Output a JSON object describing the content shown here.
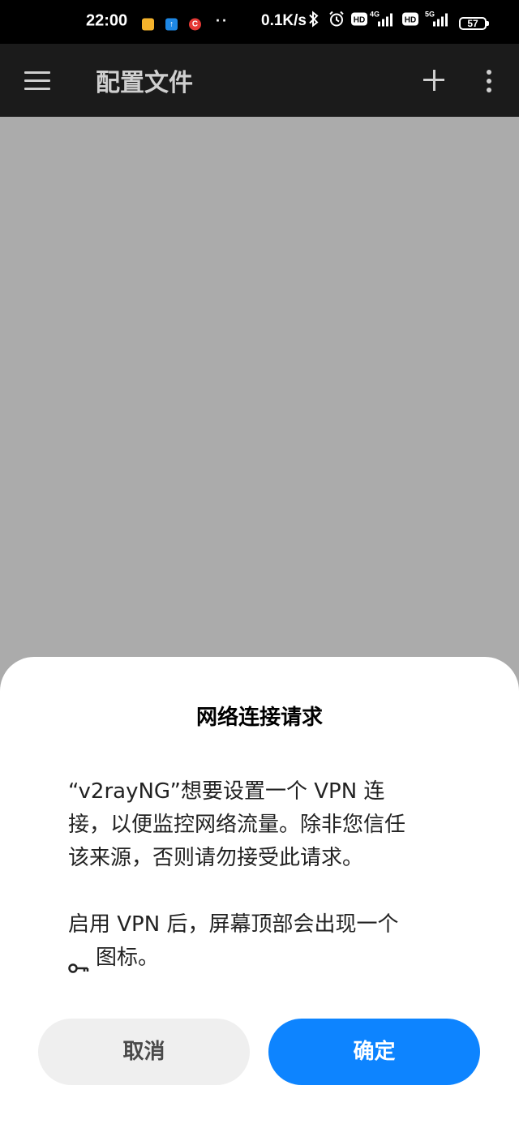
{
  "status_bar": {
    "time": "22:00",
    "dots": "··",
    "net_speed": "0.1K/s",
    "battery": "57",
    "network_1": "4G",
    "network_2": "5G",
    "hd_label": "HD",
    "notif_c_label": "C",
    "notif_arrow_label": "↑"
  },
  "app_bar": {
    "title": "配置文件"
  },
  "dialog": {
    "title": "网络连接请求",
    "message_line1": "“v2rayNG”想要设置一个 VPN 连",
    "message_line2": "接，以便监控网络流量。除非您信任",
    "message_line3": "该来源，否则请勿接受此请求。",
    "message_line4": "启用 VPN 后，屏幕顶部会出现一个",
    "message_line5_suffix": "图标。",
    "cancel_label": "取消",
    "ok_label": "确定"
  },
  "colors": {
    "primary_button": "#0d84ff",
    "cancel_button": "#efefef",
    "app_bar": "#1b1b1b",
    "scrim": "#ababab"
  }
}
